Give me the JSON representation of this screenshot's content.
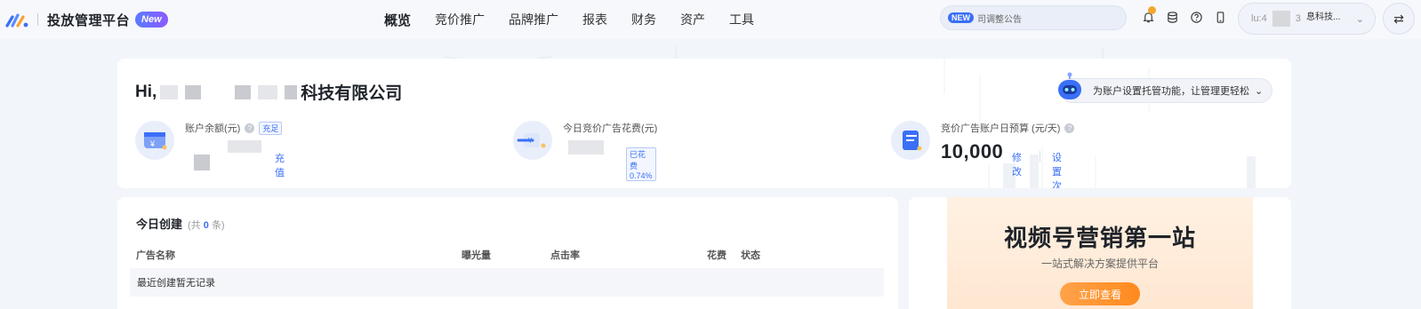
{
  "header": {
    "brand_title": "投放管理平台",
    "brand_badge": "New",
    "nav": [
      "概览",
      "竞价推广",
      "品牌推广",
      "报表",
      "财务",
      "资产",
      "工具"
    ],
    "active_nav": "概览",
    "notice": {
      "tag": "NEW",
      "text": "司调整公告"
    },
    "icons": [
      "bell-icon",
      "database-icon",
      "help-icon",
      "mobile-icon"
    ],
    "account": {
      "id_prefix": "lu:4",
      "id_suffix": "3",
      "name": "息科技...",
      "chevron": "⌄"
    },
    "switch_icon": "⇄"
  },
  "summary": {
    "greeting_prefix": "Hi,",
    "company_suffix": "科技有限公司",
    "robot_tip": "为账户设置托管功能，让管理更轻松",
    "robot_chevron": "⌄",
    "stats": [
      {
        "label": "账户余额(元)",
        "tag": "充足",
        "action": "充值"
      },
      {
        "label": "今日竞价广告花费(元)",
        "tag": "已花费 0.74%"
      },
      {
        "label": "竞价广告账户日预算 (元/天)",
        "value": "10,000",
        "action": "修改",
        "action2": "设置次日预算"
      }
    ]
  },
  "today": {
    "title": "今日创建",
    "count_prefix": "(共",
    "count": "0",
    "count_suffix": "条)",
    "columns": [
      "广告名称",
      "曝光量",
      "点击率",
      "花费",
      "状态"
    ],
    "empty_text": "最近创建暂无记录"
  },
  "promo": {
    "title": "视频号营销第一站",
    "subtitle": "一站式解决方案提供平台",
    "button": "立即查看"
  },
  "colors": {
    "accent": "#3a6ff7",
    "promo_orange": "#ff8a1e",
    "background": "#f2f5fa"
  }
}
